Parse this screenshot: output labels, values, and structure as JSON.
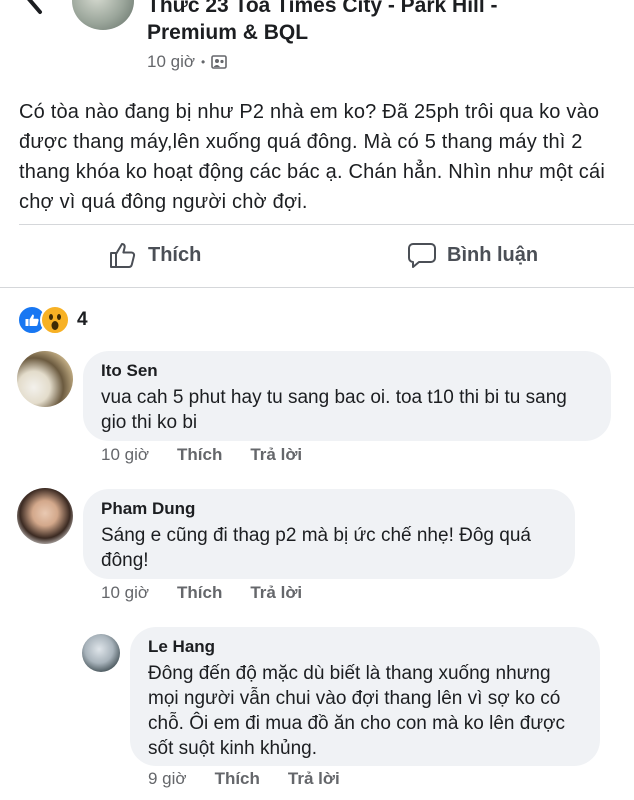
{
  "header": {
    "group_name": "Thức 23 Toà Times City - Park Hill - Premium & BQL",
    "time": "10 giờ",
    "separator": "•"
  },
  "post": {
    "text": "Có tòa nào đang bị như P2 nhà em ko? Đã 25ph trôi qua ko vào được thang máy,lên xuống quá đông. Mà có 5 thang máy thì 2 thang khóa ko hoạt động các bác ạ. Chán hẳn. Nhìn như một cái chợ vì quá đông người chờ đợi."
  },
  "actions": {
    "like_label": "Thích",
    "comment_label": "Bình luận"
  },
  "reactions": {
    "count": "4"
  },
  "comments": [
    {
      "name": "Ito Sen",
      "text": "vua cah 5 phut hay tu sang bac oi. toa t10 thi bi tu sang gio thi ko bi",
      "time": "10 giờ",
      "like": "Thích",
      "reply": "Trả lời"
    },
    {
      "name": "Pham Dung",
      "text": "Sáng e cũng đi thag p2 mà bị ức chế nhẹ! Đôg quá đông!",
      "time": "10 giờ",
      "like": "Thích",
      "reply": "Trả lời"
    },
    {
      "name": "Le Hang",
      "text": "Đông đến độ mặc dù biết là thang xuống nhưng mọi người vẫn chui vào đợi thang lên vì sợ ko có chỗ. Ôi em đi mua đồ ăn cho con mà ko lên được sốt suột kinh khủng.",
      "time": "9 giờ",
      "like": "Thích",
      "reply": "Trả lời"
    }
  ],
  "colors": {
    "accent": "#1877f2",
    "bubble": "#f0f2f5",
    "muted_text": "#65676b",
    "wow_yellow": "#f7b125"
  }
}
